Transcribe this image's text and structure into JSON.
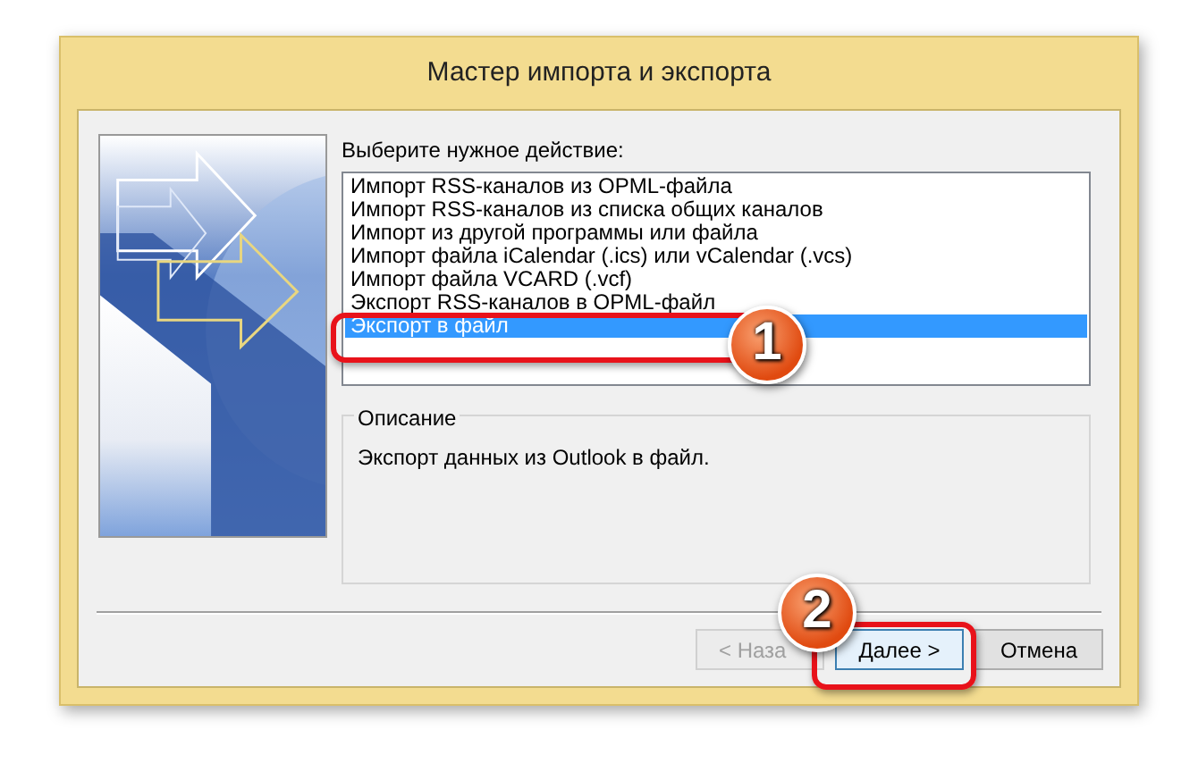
{
  "window": {
    "title": "Мастер импорта и экспорта"
  },
  "prompt": "Выберите нужное действие:",
  "actions": [
    {
      "label": "Импорт RSS-каналов из OPML-файла",
      "selected": false
    },
    {
      "label": "Импорт RSS-каналов из списка общих каналов",
      "selected": false
    },
    {
      "label": "Импорт из другой программы или файла",
      "selected": false
    },
    {
      "label": "Импорт файла iCalendar (.ics) или vCalendar (.vcs)",
      "selected": false
    },
    {
      "label": "Импорт файла VCARD (.vcf)",
      "selected": false
    },
    {
      "label": "Экспорт RSS-каналов в OPML-файл",
      "selected": false
    },
    {
      "label": "Экспорт в файл",
      "selected": true
    }
  ],
  "description": {
    "title": "Описание",
    "text": "Экспорт данных из Outlook в файл."
  },
  "buttons": [
    {
      "label": "< Наза",
      "disabled": true,
      "focused": false
    },
    {
      "label": "Далее >",
      "disabled": false,
      "focused": true
    },
    {
      "label": "Отмена",
      "disabled": false,
      "focused": false
    }
  ],
  "annotations": [
    {
      "label": "1"
    },
    {
      "label": "2"
    }
  ]
}
